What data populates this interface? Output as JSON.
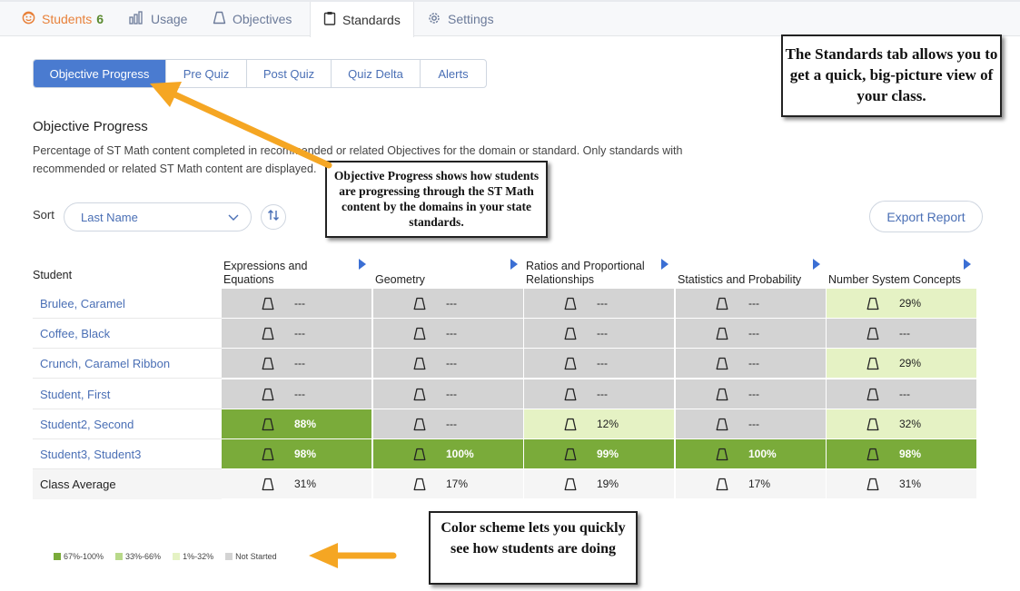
{
  "topnav": {
    "tabs": [
      {
        "label": "Students",
        "count": "6",
        "icon": "smiley-face-icon"
      },
      {
        "label": "Usage",
        "icon": "bar-chart-icon"
      },
      {
        "label": "Objectives",
        "icon": "trapezoid-icon"
      },
      {
        "label": "Standards",
        "icon": "clipboard-icon",
        "active": true
      },
      {
        "label": "Settings",
        "icon": "gear-icon"
      }
    ]
  },
  "subtabs": [
    {
      "label": "Objective Progress",
      "active": true
    },
    {
      "label": "Pre Quiz"
    },
    {
      "label": "Post Quiz"
    },
    {
      "label": "Quiz Delta"
    },
    {
      "label": "Alerts"
    }
  ],
  "section": {
    "title": "Objective Progress",
    "description": "Percentage of ST Math content completed in recommended or related Objectives for the domain or standard. Only standards with recommended or related ST Math content are displayed."
  },
  "sort": {
    "label": "Sort",
    "value": "Last Name"
  },
  "export_label": "Export Report",
  "table": {
    "student_header": "Student",
    "columns": [
      "Expressions and Equations",
      "Geometry",
      "Ratios and Proportional Relationships",
      "Statistics and Probability",
      "Number System Concepts"
    ],
    "rows": [
      {
        "name": "Brulee, Caramel",
        "values": [
          "---",
          "---",
          "---",
          "---",
          "29%"
        ],
        "levels": [
          "ns",
          "ns",
          "ns",
          "ns",
          "low"
        ]
      },
      {
        "name": "Coffee, Black",
        "values": [
          "---",
          "---",
          "---",
          "---",
          "---"
        ],
        "levels": [
          "ns",
          "ns",
          "ns",
          "ns",
          "ns"
        ]
      },
      {
        "name": "Crunch, Caramel Ribbon",
        "values": [
          "---",
          "---",
          "---",
          "---",
          "29%"
        ],
        "levels": [
          "ns",
          "ns",
          "ns",
          "ns",
          "low"
        ]
      },
      {
        "name": "Student, First",
        "values": [
          "---",
          "---",
          "---",
          "---",
          "---"
        ],
        "levels": [
          "ns",
          "ns",
          "ns",
          "ns",
          "ns"
        ]
      },
      {
        "name": "Student2, Second",
        "values": [
          "88%",
          "---",
          "12%",
          "---",
          "32%"
        ],
        "levels": [
          "high",
          "ns",
          "low",
          "ns",
          "low"
        ]
      },
      {
        "name": "Student3, Student3",
        "values": [
          "98%",
          "100%",
          "99%",
          "100%",
          "98%"
        ],
        "levels": [
          "high",
          "high",
          "high",
          "high",
          "high"
        ]
      }
    ],
    "average": {
      "name": "Class Average",
      "values": [
        "31%",
        "17%",
        "19%",
        "17%",
        "31%"
      ]
    }
  },
  "legend": [
    {
      "label": "67%-100%",
      "color": "#7aab3a"
    },
    {
      "label": "33%-66%",
      "color": "#b8d98a"
    },
    {
      "label": "1%-32%",
      "color": "#e5f2c4"
    },
    {
      "label": "Not Started",
      "color": "#d3d3d3"
    }
  ],
  "callouts": {
    "standards": "The Standards tab allows you to get a quick, big-picture view of your class.",
    "objective_progress": "Objective Progress shows how students are progressing through the ST Math content by the domains in your state standards.",
    "color_scheme": "Color scheme lets you quickly see how students are doing"
  },
  "colors": {
    "accent": "#4a7bd0",
    "link": "#4a6fb5",
    "arrow": "#f5a623"
  }
}
